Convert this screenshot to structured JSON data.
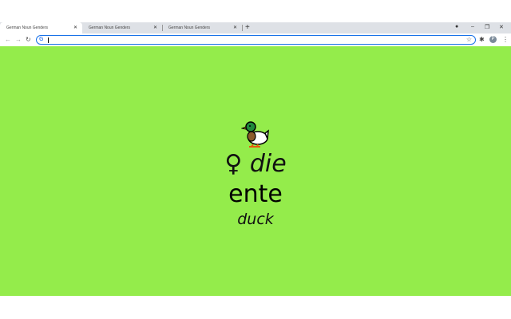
{
  "tabs": [
    {
      "label": "German Noun Genders",
      "active": true
    },
    {
      "label": "German Noun Genders",
      "active": false
    },
    {
      "label": "German Noun Genders",
      "active": false
    }
  ],
  "address_bar": {
    "value": ""
  },
  "profile_initial": "P",
  "card": {
    "emoji": "duck-icon",
    "gender_symbol": "♀",
    "article": "die",
    "noun": "ente",
    "translation": "duck",
    "background": "#94ec4b"
  }
}
